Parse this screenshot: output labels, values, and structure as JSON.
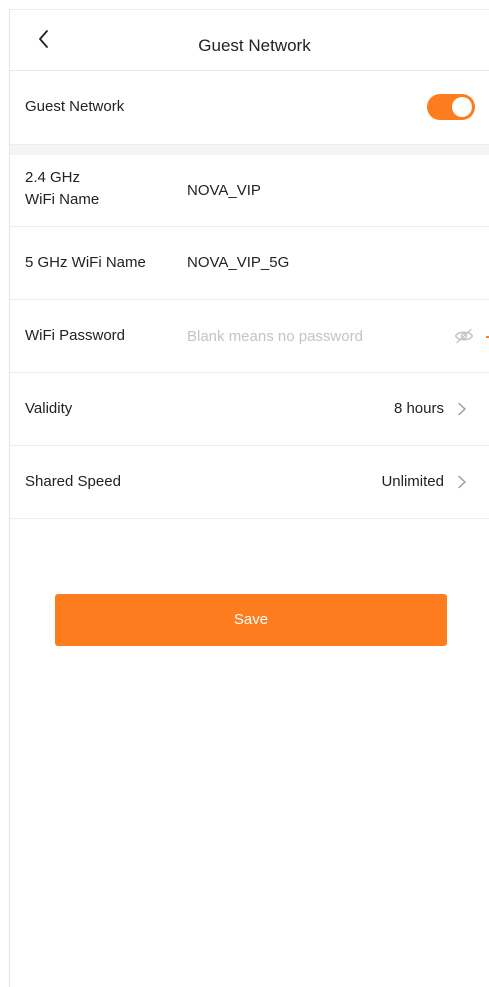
{
  "header": {
    "title": "Guest Network",
    "back_icon": "chevron-left-icon"
  },
  "guest_toggle": {
    "label": "Guest Network",
    "enabled": true,
    "color": "#fd7d1e"
  },
  "wifi_24": {
    "label": "2.4 GHz\nWiFi Name",
    "value": "NOVA_VIP"
  },
  "wifi_5": {
    "label": "5 GHz WiFi Name",
    "value": "NOVA_VIP_5G"
  },
  "password": {
    "label": "WiFi Password",
    "value": "",
    "placeholder": "Blank means no password",
    "visibility_icon": "eye-hidden-icon"
  },
  "validity": {
    "label": "Validity",
    "value": "8 hours",
    "icon": "chevron-right-icon"
  },
  "shared_speed": {
    "label": "Shared Speed",
    "value": "Unlimited",
    "icon": "chevron-right-icon"
  },
  "save": {
    "label": "Save",
    "color": "#fd7d1e"
  }
}
